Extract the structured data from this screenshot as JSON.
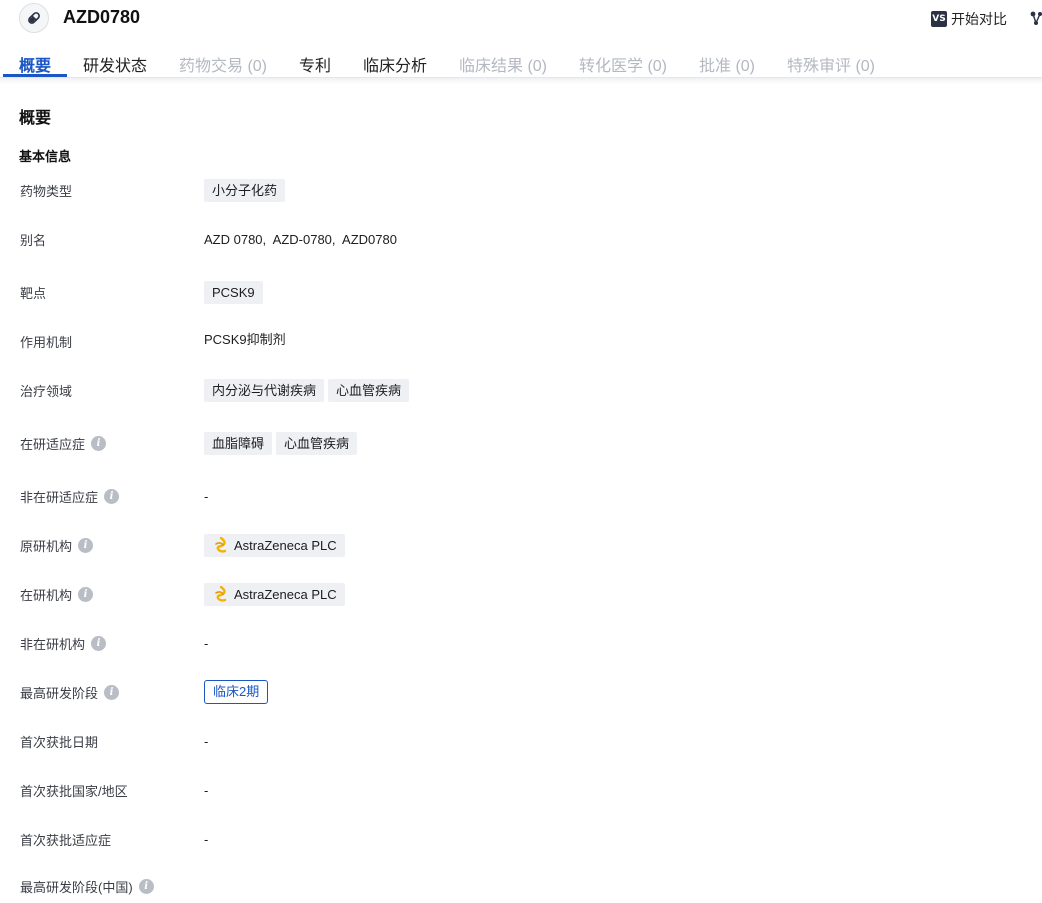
{
  "header": {
    "drug_name": "AZD0780",
    "compare_icon_text": "VS",
    "compare_label": "开始对比"
  },
  "tabs": [
    {
      "label": "概要",
      "state": "active"
    },
    {
      "label": "研发状态",
      "state": "enabled"
    },
    {
      "label": "药物交易 (0)",
      "state": "disabled"
    },
    {
      "label": "专利",
      "state": "enabled"
    },
    {
      "label": "临床分析",
      "state": "enabled"
    },
    {
      "label": "临床结果 (0)",
      "state": "disabled"
    },
    {
      "label": "转化医学 (0)",
      "state": "disabled"
    },
    {
      "label": "批准 (0)",
      "state": "disabled"
    },
    {
      "label": "特殊审评 (0)",
      "state": "disabled"
    }
  ],
  "overview": {
    "section_title": "概要",
    "basic_info_title": "基本信息",
    "fields": {
      "drug_type": {
        "label": "药物类型",
        "tags": [
          "小分子化药"
        ]
      },
      "aliases": {
        "label": "别名",
        "value": "AZD 0780,  AZD-0780,  AZD0780"
      },
      "target": {
        "label": "靶点",
        "tags": [
          "PCSK9"
        ]
      },
      "mechanism": {
        "label": "作用机制",
        "value": "PCSK9抑制剂"
      },
      "therapeutic_area": {
        "label": "治疗领域",
        "tags": [
          "内分泌与代谢疾病",
          "心血管疾病"
        ]
      },
      "active_indication": {
        "label": "在研适应症",
        "tags": [
          "血脂障碍",
          "心血管疾病"
        ]
      },
      "inactive_indication": {
        "label": "非在研适应症",
        "value": "-"
      },
      "originator": {
        "label": "原研机构",
        "org": "AstraZeneca PLC"
      },
      "active_org": {
        "label": "在研机构",
        "org": "AstraZeneca PLC"
      },
      "inactive_org": {
        "label": "非在研机构",
        "value": "-"
      },
      "highest_phase": {
        "label": "最高研发阶段",
        "stage": "临床2期"
      },
      "first_approval_date": {
        "label": "首次获批日期",
        "value": "-"
      },
      "first_approval_country": {
        "label": "首次获批国家/地区",
        "value": "-"
      },
      "first_approval_indication": {
        "label": "首次获批适应症",
        "value": "-"
      },
      "highest_phase_china": {
        "label": "最高研发阶段(中国)"
      }
    }
  },
  "icons": {
    "drug": "pill-icon",
    "compare": "vs-icon",
    "share": "share-icon",
    "info": "info-icon",
    "org_logo": "astrazeneca-logo-icon"
  },
  "colors": {
    "accent": "#1a56c5",
    "tag_bg": "#eef0f3",
    "disabled_text": "#b4b8c1",
    "org_logo": "#f2b400"
  }
}
